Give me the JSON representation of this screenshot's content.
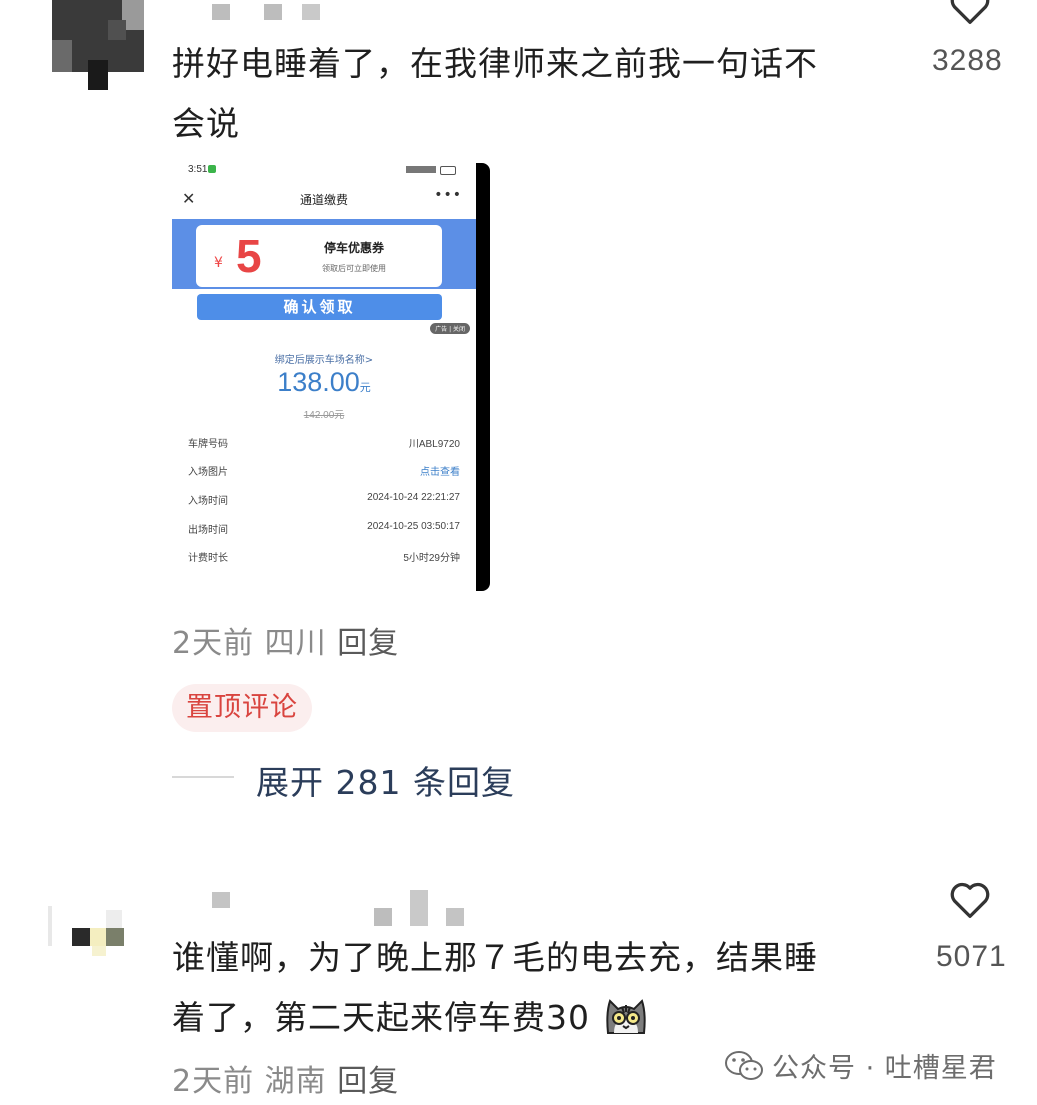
{
  "comments": [
    {
      "text_line1": "拼好电睡着了，在我律师来之前我一句话不",
      "text_line2": "会说",
      "likes": "3288",
      "time": "2天前",
      "location": "四川",
      "reply_label": "回复",
      "pin_label": "置顶评论",
      "expand_label": "展开 281 条回复",
      "screenshot": {
        "status_time": "3:51",
        "title": "通道缴费",
        "coupon_symbol": "¥",
        "coupon_amount": "5",
        "coupon_title": "停车优惠券",
        "coupon_sub": "领取后可立即使用",
        "confirm_label": "确认领取",
        "ad_tag": "广告 | 关闭",
        "bind_text": "绑定后展示车场名称>",
        "price": "138.00",
        "price_unit": "元",
        "old_price": "142.00元",
        "rows": [
          {
            "key": "车牌号码",
            "value": "川ABL9720"
          },
          {
            "key": "入场图片",
            "value": "点击查看"
          },
          {
            "key": "入场时间",
            "value": "2024-10-24 22:21:27"
          },
          {
            "key": "出场时间",
            "value": "2024-10-25 03:50:17"
          },
          {
            "key": "计费时长",
            "value": "5小时29分钟"
          }
        ]
      }
    },
    {
      "text_line1": "谁懂啊，为了晚上那７毛的电去充，结果睡",
      "text_line2": "着了，第二天起来停车费30",
      "likes": "5071",
      "time": "2天前",
      "location": "湖南",
      "reply_label": "回复"
    }
  ],
  "watermark": "公众号 · 吐槽星君",
  "colors": {
    "pin_bg": "#fbeeee",
    "pin_text": "#d9443f",
    "expand_text": "#2b3d5a",
    "accent_blue": "#4e8ee8"
  }
}
